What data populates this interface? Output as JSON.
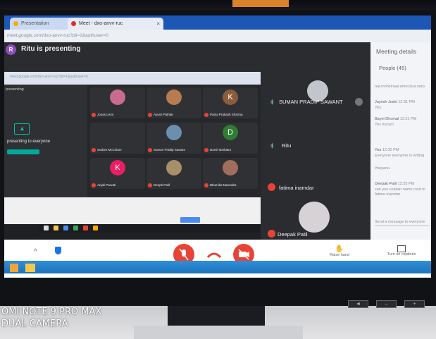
{
  "browser": {
    "tab1_label": "Presentation",
    "tab2_label": "Meet - dxo-anvv-ruc",
    "tab_close": "×",
    "new_tab": "+",
    "url": "meet.google.com/dxo-anvv-ruc?pli=1&authuser=0"
  },
  "meet": {
    "presenter_initial": "R",
    "presenting_text": "Ritu is presenting"
  },
  "shared_screen": {
    "left_label": "presenting",
    "present_to_everyone": "presenting to everyone",
    "grid_tiles": [
      {
        "name": "Jonas Lemi",
        "kind": "face",
        "color": "#c96b8e"
      },
      {
        "name": "Ayush Pathak",
        "kind": "face",
        "color": "#b67c4f"
      },
      {
        "name": "Patna Prakash Sharma",
        "kind": "letter",
        "letter": "K",
        "color": "#8b5c3c"
      },
      {
        "name": "Sodom McColam",
        "kind": "blank",
        "color": "#303134"
      },
      {
        "name": "Suman Pradip Sawant",
        "kind": "face",
        "color": "#6c8fb0"
      },
      {
        "name": "Darsh Barkatur",
        "kind": "letter",
        "letter": "D",
        "color": "#2e7d32"
      },
      {
        "name": "Anjali Parvati",
        "kind": "letter",
        "letter": "K",
        "color": "#e91e63"
      },
      {
        "name": "Deepti Patil",
        "kind": "face",
        "color": "#a88f6a"
      },
      {
        "name": "Bhumika Narendra",
        "kind": "face",
        "color": "#a06e5c"
      }
    ]
  },
  "participants": [
    {
      "name": "SUMAN PRADIP SAWANT",
      "indicator": "wave"
    },
    {
      "name": "Ritu",
      "indicator": "wave"
    },
    {
      "name": "fatima inamdar",
      "indicator": "mic-off"
    },
    {
      "name": "Deepak Patil",
      "indicator": "mic-off"
    }
  ],
  "panel": {
    "title": "Meeting details",
    "people": "People (45)",
    "chats": [
      {
        "author": "",
        "text": "nat.mohsinaai.amol.dua.nerp"
      },
      {
        "author": "Jayesh Joshi",
        "time": "12:31 PM",
        "text": "Yes"
      },
      {
        "author": "Bayei Dhumal",
        "time": "12:31 PM",
        "text": "Yes ma'am"
      },
      {
        "author": "You",
        "time": "12:32 PM",
        "text": "Everyone everyone is writing"
      },
      {
        "author": "",
        "text": "#nayana"
      },
      {
        "author": "Deepak Patil",
        "time": "12:35 PM",
        "text": "can you explain name card to fatima inamdar"
      }
    ],
    "chat_input": "Send a message to everyone"
  },
  "controls": {
    "raise_hand": "Raise hand",
    "captions": "Turn on captions",
    "up_caret": "^"
  },
  "monitor": {
    "buttons": [
      "◄",
      "–",
      "+"
    ]
  },
  "watermark": {
    "line1": "OMI NOTE 9 PRO MAX",
    "line2": "DUAL CAMERA"
  }
}
